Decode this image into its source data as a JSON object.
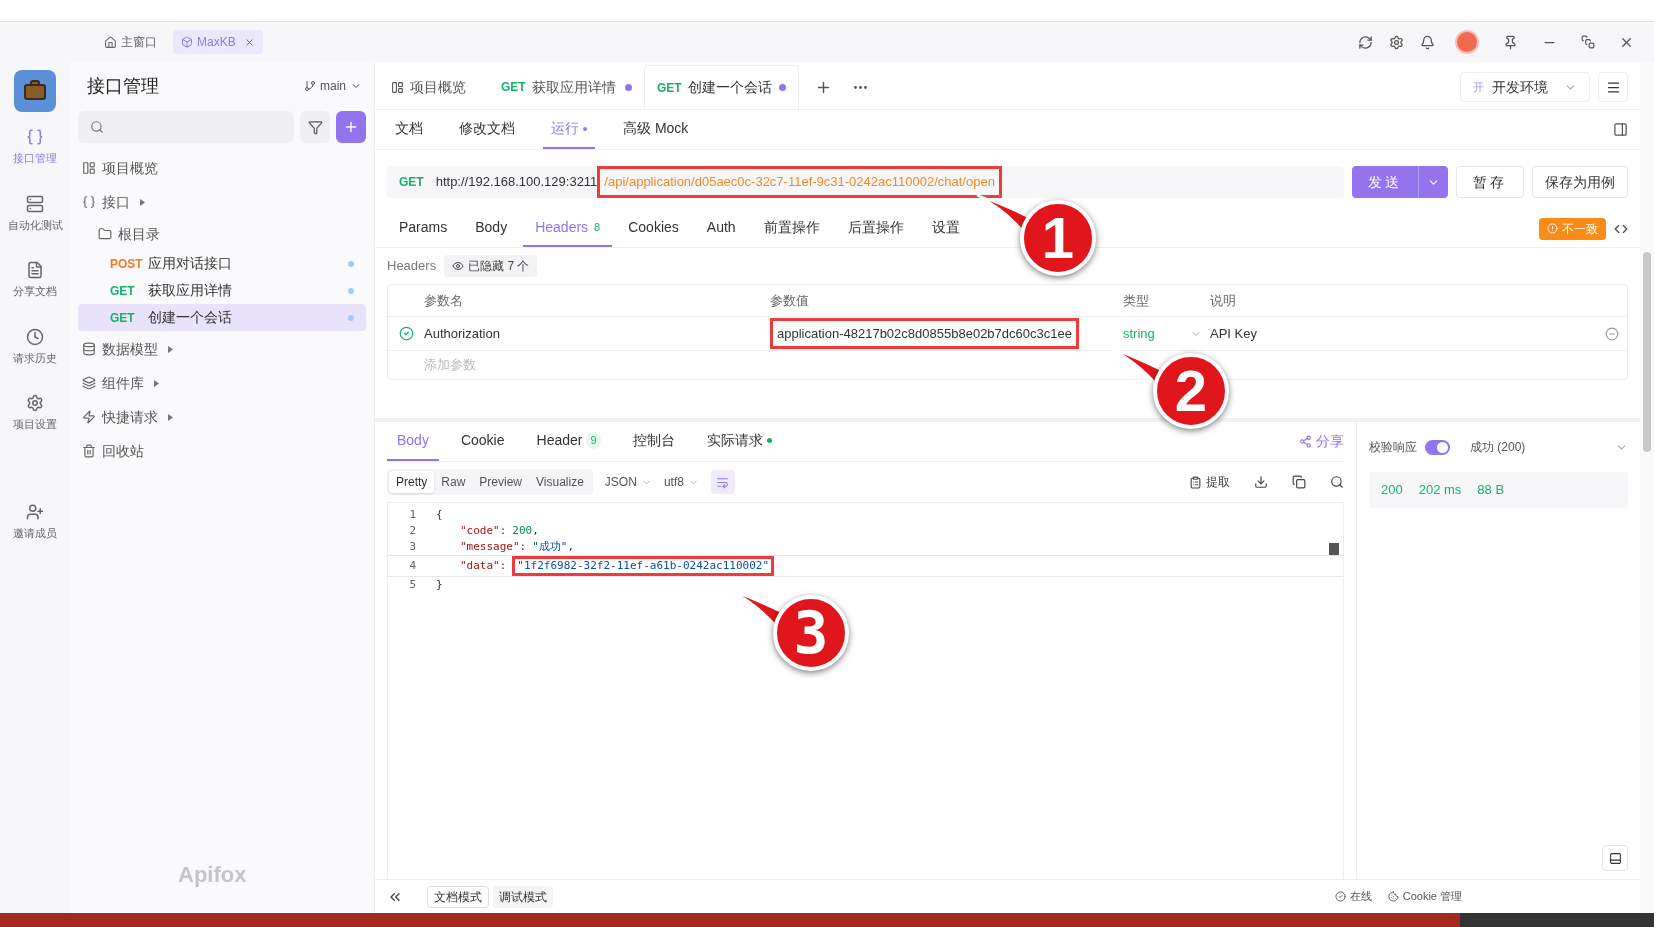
{
  "titlebar": {
    "tabs": [
      {
        "label": "主窗口",
        "kind": "home",
        "selected": false
      },
      {
        "label": "MaxKB",
        "kind": "project",
        "selected": true
      }
    ]
  },
  "rail": [
    {
      "label": "接口管理",
      "kind": "api",
      "selected": true
    },
    {
      "label": "自动化测试",
      "kind": "test",
      "selected": false
    },
    {
      "label": "分享文档",
      "kind": "doc",
      "selected": false
    },
    {
      "label": "请求历史",
      "kind": "history",
      "selected": false
    },
    {
      "label": "项目设置",
      "kind": "settings",
      "selected": false
    },
    {
      "label": "邀请成员",
      "kind": "invite",
      "selected": false
    }
  ],
  "sidebar": {
    "title": "接口管理",
    "branch": "main",
    "tree": [
      {
        "label": "项目概览",
        "kind": "overview",
        "expandable": false
      },
      {
        "label": "接口",
        "kind": "api",
        "expandable": true,
        "children": [
          {
            "label": "根目录",
            "kind": "folder",
            "children": [
              {
                "method": "POST",
                "label": "应用对话接口",
                "selected": false
              },
              {
                "method": "GET",
                "label": "获取应用详情",
                "selected": false
              },
              {
                "method": "GET",
                "label": "创建一个会话",
                "selected": true
              }
            ]
          }
        ]
      },
      {
        "label": "数据模型",
        "kind": "model",
        "expandable": true
      },
      {
        "label": "组件库",
        "kind": "components",
        "expandable": true
      },
      {
        "label": "快捷请求",
        "kind": "quick",
        "expandable": true
      },
      {
        "label": "回收站",
        "kind": "trash",
        "expandable": false
      }
    ],
    "brand": "Apifox"
  },
  "doc_tabs": [
    {
      "kind": "overview",
      "label": "项目概览",
      "selected": false,
      "unsaved": false
    },
    {
      "kind": "request",
      "method": "GET",
      "label": "获取应用详情",
      "selected": false,
      "unsaved": true
    },
    {
      "kind": "request",
      "method": "GET",
      "label": "创建一个会话",
      "selected": true,
      "unsaved": true
    }
  ],
  "env": {
    "prefix": "开",
    "label": "开发环境"
  },
  "sub_tabs": [
    {
      "label": "文档",
      "selected": false,
      "dot": false
    },
    {
      "label": "修改文档",
      "selected": false,
      "dot": false
    },
    {
      "label": "运行",
      "selected": true,
      "dot": true
    },
    {
      "label": "高级 Mock",
      "selected": false,
      "dot": false
    }
  ],
  "request": {
    "method": "GET",
    "url_base": "http://192.168.100.129:3211",
    "url_path": "/api/application/d05aec0c-32c7-11ef-9c31-0242ac110002/chat/open",
    "send": "发送",
    "save_temp": "暂存",
    "save_case": "保存为用例"
  },
  "param_tabs": [
    {
      "label": "Params",
      "selected": false
    },
    {
      "label": "Body",
      "selected": false
    },
    {
      "label": "Headers",
      "count": "8",
      "selected": true
    },
    {
      "label": "Cookies",
      "selected": false
    },
    {
      "label": "Auth",
      "selected": false
    },
    {
      "label": "前置操作",
      "selected": false
    },
    {
      "label": "后置操作",
      "selected": false
    },
    {
      "label": "设置",
      "selected": false
    }
  ],
  "mismatch": "不一致",
  "headers": {
    "label": "Headers",
    "hidden": "已隐藏 7 个",
    "columns": [
      "参数名",
      "参数值",
      "类型",
      "说明"
    ],
    "rows": [
      {
        "enabled": true,
        "name": "Authorization",
        "value": "application-48217b02c8d0855b8e02b7dc60c3c1ee",
        "type": "string",
        "description": "API Key"
      }
    ],
    "add_placeholder": "添加参数"
  },
  "response_tabs": [
    {
      "label": "Body",
      "selected": true,
      "dot": false
    },
    {
      "label": "Cookie",
      "selected": false,
      "dot": false
    },
    {
      "label": "Header",
      "count": "9",
      "selected": false,
      "dot": false
    },
    {
      "label": "控制台",
      "selected": false,
      "dot": false
    },
    {
      "label": "实际请求",
      "selected": false,
      "dot": true
    }
  ],
  "share": "分享",
  "view_modes": [
    {
      "label": "Pretty",
      "selected": true
    },
    {
      "label": "Raw",
      "selected": false
    },
    {
      "label": "Preview",
      "selected": false
    },
    {
      "label": "Visualize",
      "selected": false
    }
  ],
  "format": "JSON",
  "encoding": "utf8",
  "extract": "提取",
  "code_lines": [
    {
      "num": "1",
      "kind": "brace",
      "text": "{",
      "current": false
    },
    {
      "num": "2",
      "kind": "number",
      "key": "\"code\":",
      "value": "200",
      "tail": ",",
      "current": false
    },
    {
      "num": "3",
      "kind": "string",
      "key": "\"message\":",
      "value": "\"成功\"",
      "tail": ",",
      "current": false
    },
    {
      "num": "4",
      "kind": "string",
      "key": "\"data\":",
      "value": "\"1f2f6982-32f2-11ef-a61b-0242ac110002\"",
      "current": true
    },
    {
      "num": "5",
      "kind": "brace",
      "text": "}",
      "current": false
    }
  ],
  "validation": {
    "label": "校验响应",
    "on": true,
    "result": "成功 (200)"
  },
  "stats": [
    "200",
    "202 ms",
    "88 B"
  ],
  "footer": {
    "modes": [
      {
        "label": "文档模式",
        "selected": true
      },
      {
        "label": "调试模式",
        "selected": false
      }
    ],
    "status": [
      {
        "kind": "online",
        "label": "在线"
      },
      {
        "kind": "cookie",
        "label": "Cookie 管理"
      }
    ]
  },
  "annotations": [
    {
      "number": "1"
    },
    {
      "number": "2"
    },
    {
      "number": "3"
    }
  ]
}
